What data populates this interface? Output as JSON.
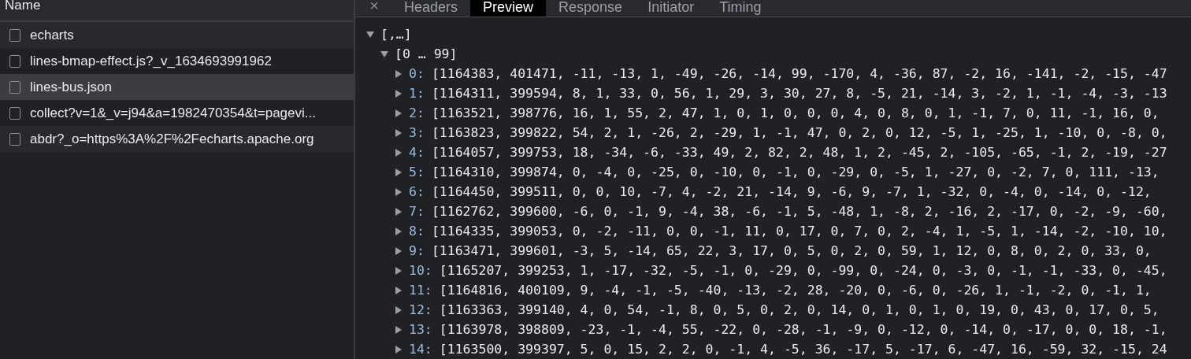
{
  "requests_panel": {
    "column_header": "Name",
    "requests": [
      {
        "name": "echarts",
        "checked": false,
        "selected": false
      },
      {
        "name": "lines-bmap-effect.js?_v_1634693991962",
        "checked": false,
        "selected": false
      },
      {
        "name": "lines-bus.json",
        "checked": false,
        "selected": true
      },
      {
        "name": "collect?v=1&_v=j94&a=1982470354&t=pagevi...",
        "checked": false,
        "selected": false
      },
      {
        "name": "abdr?_o=https%3A%2F%2Fecharts.apache.org",
        "checked": false,
        "selected": false
      }
    ]
  },
  "detail_panel": {
    "close_label": "×",
    "tabs": [
      {
        "label": "Headers",
        "selected": false
      },
      {
        "label": "Preview",
        "selected": true
      },
      {
        "label": "Response",
        "selected": false
      },
      {
        "label": "Initiator",
        "selected": false
      },
      {
        "label": "Timing",
        "selected": false
      }
    ],
    "tree": [
      {
        "label": "[,…]",
        "expanded": true,
        "children": [
          {
            "label": "[0 … 99]",
            "expanded": true,
            "children": [
              {
                "index": "0:",
                "value": "[1164383, 401471, -11, -13, 1, -49, -26, -14, 99, -170, 4, -36, 87, -2, 16, -141, -2, -15, -47",
                "expanded": false
              },
              {
                "index": "1:",
                "value": "[1164311, 399594, 8, 1, 33, 0, 56, 1, 29, 3, 30, 27, 8, -5, 21, -14, 3, -2, 1, -1, -4, -3, -13",
                "expanded": false
              },
              {
                "index": "2:",
                "value": "[1163521, 398776, 16, 1, 55, 2, 47, 1, 0, 1, 0, 0, 0, 4, 0, 8, 0, 1, -1, 7, 0, 11, -1, 16, 0,",
                "expanded": false
              },
              {
                "index": "3:",
                "value": "[1163823, 399822, 54, 2, 1, -26, 2, -29, 1, -1, 47, 0, 2, 0, 12, -5, 1, -25, 1, -10, 0, -8, 0,",
                "expanded": false
              },
              {
                "index": "4:",
                "value": "[1164057, 399753, 18, -34, -6, -33, 49, 2, 82, 2, 48, 1, 2, -45, 2, -105, -65, -1, 2, -19, -27",
                "expanded": false
              },
              {
                "index": "5:",
                "value": "[1164310, 399874, 0, -4, 0, -25, 0, -10, 0, -1, 0, -29, 0, -5, 1, -27, 0, -2, 7, 0, 111, -13,",
                "expanded": false
              },
              {
                "index": "6:",
                "value": "[1164450, 399511, 0, 0, 10, -7, 4, -2, 21, -14, 9, -6, 9, -7, 1, -32, 0, -4, 0, -14, 0, -12,",
                "expanded": false
              },
              {
                "index": "7:",
                "value": "[1162762, 399600, -6, 0, -1, 9, -4, 38, -6, -1, 5, -48, 1, -8, 2, -16, 2, -17, 0, -2, -9, -60,",
                "expanded": false
              },
              {
                "index": "8:",
                "value": "[1164335, 399053, 0, -2, -11, 0, 0, -1, 11, 0, 17, 0, 7, 0, 2, -4, 1, -5, 1, -14, -2, -10, 10,",
                "expanded": false
              },
              {
                "index": "9:",
                "value": "[1163471, 399601, -3, 5, -14, 65, 22, 3, 17, 0, 5, 0, 2, 0, 59, 1, 12, 0, 8, 0, 2, 0, 33, 0,",
                "expanded": false
              },
              {
                "index": "10:",
                "value": "[1165207, 399253, 1, -17, -32, -5, -1, 0, -29, 0, -99, 0, -24, 0, -3, 0, -1, -1, -33, 0, -45,",
                "expanded": false
              },
              {
                "index": "11:",
                "value": "[1164816, 400109, 9, -4, -1, -5, -40, -13, -2, 28, -20, 0, -6, 0, -26, 1, -1, -2, 0, -1, 1,",
                "expanded": false
              },
              {
                "index": "12:",
                "value": "[1163363, 399140, 4, 0, 54, -1, 8, 0, 5, 0, 2, 0, 14, 0, 1, 0, 1, 0, 19, 0, 43, 0, 17, 0, 5,",
                "expanded": false
              },
              {
                "index": "13:",
                "value": "[1163978, 398809, -23, -1, -4, 55, -22, 0, -28, -1, -9, 0, -12, 0, -14, 0, -17, 0, 0, 18, -1,",
                "expanded": false
              },
              {
                "index": "14:",
                "value": "[1163500, 399397, 5, 0, 15, 2, 2, 0, -1, 4, -5, 36, -17, 5, -17, 6, -47, 16, -59, 32, -15, 24",
                "expanded": false
              }
            ]
          }
        ]
      }
    ]
  }
}
